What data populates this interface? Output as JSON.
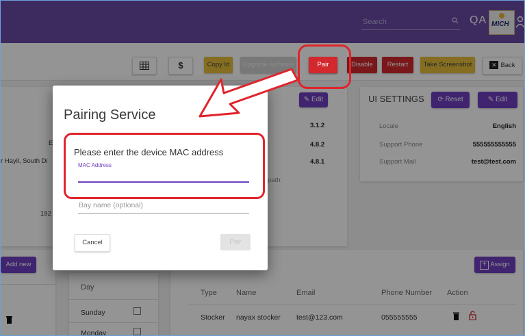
{
  "header": {
    "search_placeholder": "Search",
    "user_initials": "QA",
    "logo_text": "MICH",
    "logo_subtext": "PHARMA"
  },
  "toolbar": {
    "copy_id": "Copy Id",
    "upgrade": "Upgrade software",
    "pair": "Pair",
    "disable": "Disable",
    "restart": "Restart",
    "screenshot": "Take Screenshot",
    "back": "Back"
  },
  "versions_panel": {
    "edit": "Edit",
    "v1": "3.1.2",
    "v2": "4.8.2",
    "v3": "4.8.1",
    "path_label": "path:"
  },
  "left_panel": {
    "address_fragment": "r Hayil, South Di",
    "letter": "E",
    "number_fragment": "192"
  },
  "ui_settings": {
    "title": "UI SETTINGS",
    "reset": "Reset",
    "edit": "Edit",
    "rows": [
      {
        "label": "Locale",
        "value": "English"
      },
      {
        "label": "Support Phone",
        "value": "555555555555"
      },
      {
        "label": "Support Mail",
        "value": "test@test.com"
      }
    ]
  },
  "bottom_left": {
    "add_new": "Add new"
  },
  "days": {
    "header": "Day",
    "items": [
      "Sunday",
      "Monday"
    ]
  },
  "users": {
    "assign": "Assign",
    "columns": [
      "Type",
      "Name",
      "Email",
      "Phone Number",
      "Action"
    ],
    "rows": [
      {
        "type": "Stocker",
        "name": "nayax stocker",
        "email": "test@123.com",
        "phone": "055555555"
      }
    ]
  },
  "dialog": {
    "title": "Pairing Service",
    "prompt": "Please enter the device MAC address",
    "mac_label": "MAC Address",
    "bay_placeholder": "Bay name (optional)",
    "cancel": "Cancel",
    "pair": "Pair"
  },
  "colors": {
    "brand_purple": "#6a4aa5",
    "accent": "#6e3fc0",
    "yellow_button": "#e6bd3a",
    "red_button": "#d2282e",
    "highlight": "#e0242b"
  }
}
